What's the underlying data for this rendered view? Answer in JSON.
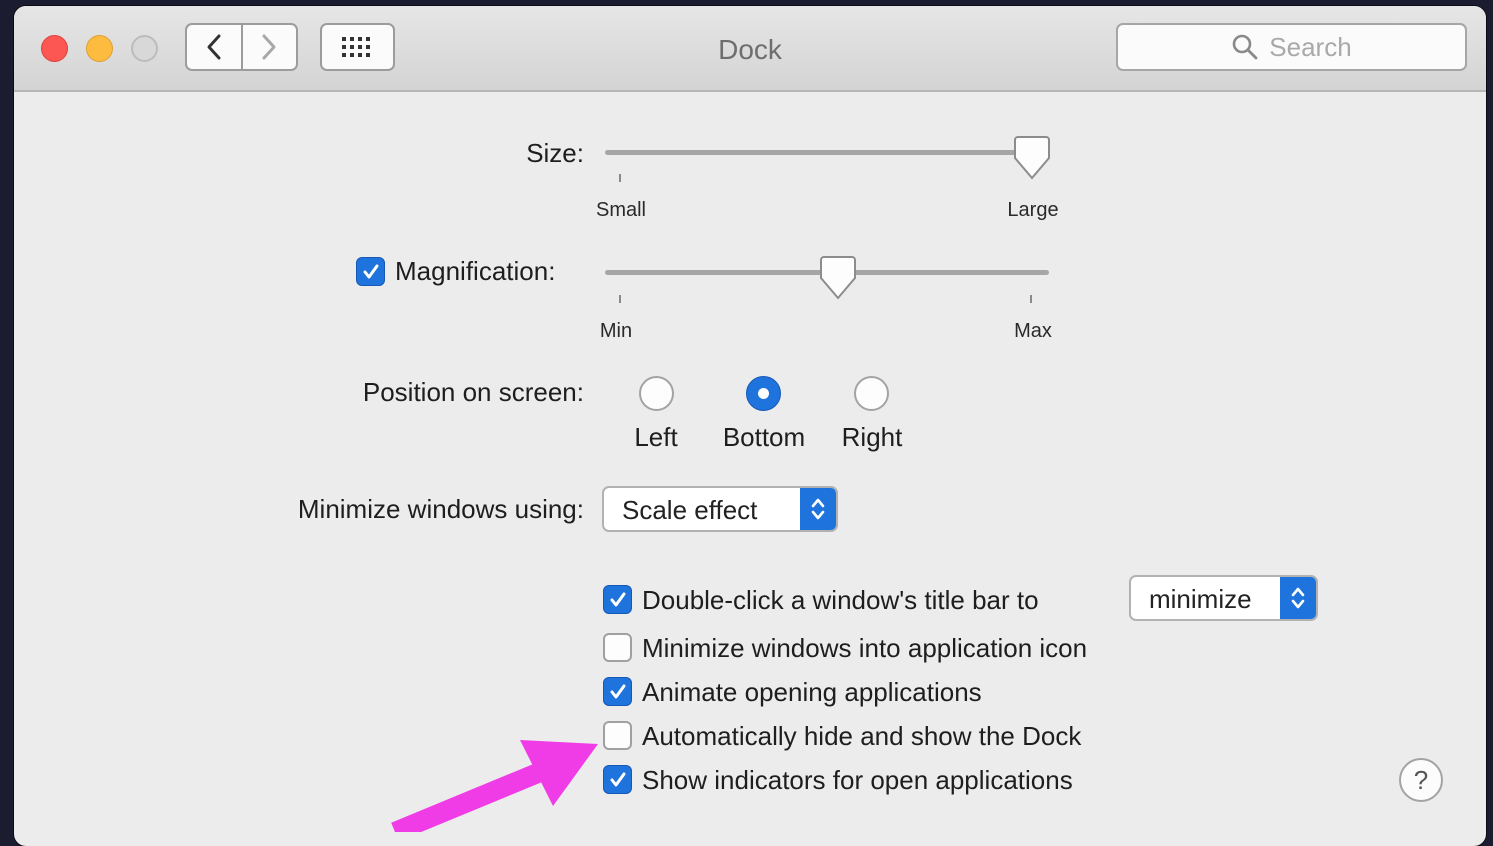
{
  "window": {
    "title": "Dock"
  },
  "toolbar": {
    "back_icon": "chevron-left-icon",
    "forward_icon": "chevron-right-icon",
    "grid_icon": "grid-icon",
    "search_placeholder": "Search"
  },
  "size": {
    "label": "Size:",
    "min_label": "Small",
    "max_label": "Large",
    "value_fraction": 0.96
  },
  "magnification": {
    "label": "Magnification:",
    "checked": true,
    "min_label": "Min",
    "max_label": "Max",
    "value_fraction": 0.53
  },
  "position": {
    "label": "Position on screen:",
    "options": [
      "Left",
      "Bottom",
      "Right"
    ],
    "selected": "Bottom"
  },
  "minimize_effect": {
    "label": "Minimize windows using:",
    "value": "Scale effect"
  },
  "options": {
    "double_click": {
      "label": "Double-click a window's title bar to",
      "checked": true,
      "action": "minimize"
    },
    "minimize_into_icon": {
      "label": "Minimize windows into application icon",
      "checked": false
    },
    "animate_opening": {
      "label": "Animate opening applications",
      "checked": true
    },
    "autohide": {
      "label": "Automatically hide and show the Dock",
      "checked": false
    },
    "show_indicators": {
      "label": "Show indicators for open applications",
      "checked": true
    }
  },
  "help": {
    "label": "?"
  },
  "annotation": {
    "arrow_color": "#f03ce6"
  },
  "colors": {
    "accent": "#1e73dd"
  }
}
